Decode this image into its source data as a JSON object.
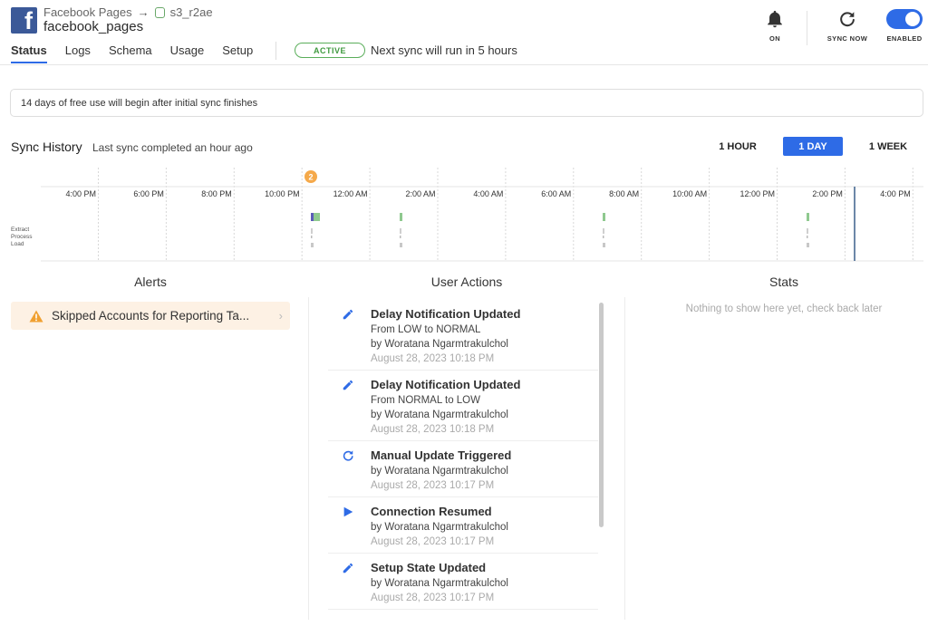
{
  "header": {
    "breadcrumb_parent": "Facebook Pages",
    "breadcrumb_dest": "s3_r2ae",
    "connector_name": "facebook_pages",
    "tabs": [
      {
        "label": "Status",
        "active": true
      },
      {
        "label": "Logs",
        "active": false
      },
      {
        "label": "Schema",
        "active": false
      },
      {
        "label": "Usage",
        "active": false
      },
      {
        "label": "Setup",
        "active": false
      }
    ],
    "status_badge": "ACTIVE",
    "next_sync": "Next sync will run in 5 hours",
    "controls": {
      "notifications_label": "ON",
      "sync_now_label": "SYNC NOW",
      "enabled_label": "ENABLED"
    }
  },
  "notice": "14 days of free use will begin after initial sync finishes",
  "sync_history": {
    "title": "Sync History",
    "subtitle": "Last sync completed an hour ago",
    "ranges": [
      {
        "label": "1 HOUR",
        "active": false
      },
      {
        "label": "1 DAY",
        "active": true
      },
      {
        "label": "1 WEEK",
        "active": false
      }
    ],
    "time_labels": [
      "4:00 PM",
      "6:00 PM",
      "8:00 PM",
      "10:00 PM",
      "12:00 AM",
      "2:00 AM",
      "4:00 AM",
      "6:00 AM",
      "8:00 AM",
      "10:00 AM",
      "12:00 PM",
      "2:00 PM",
      "4:00 PM"
    ],
    "row_labels": [
      "Extract",
      "Process",
      "Load"
    ],
    "event_badge": "2",
    "colors": {
      "extract": "#7fbf7f",
      "accent": "#2e6be6",
      "badge": "#f5a94a",
      "current_time": "#3b5f8a"
    }
  },
  "alerts": {
    "title": "Alerts",
    "items": [
      {
        "label": "Skipped Accounts for Reporting Ta...",
        "icon": "warning-icon"
      }
    ]
  },
  "user_actions": {
    "title": "User Actions",
    "items": [
      {
        "icon": "pencil-icon",
        "title": "Delay Notification Updated",
        "detail": "From LOW to NORMAL",
        "by": "by Woratana Ngarmtrakulchol",
        "time": "August 28, 2023 10:18 PM"
      },
      {
        "icon": "pencil-icon",
        "title": "Delay Notification Updated",
        "detail": "From NORMAL to LOW",
        "by": "by Woratana Ngarmtrakulchol",
        "time": "August 28, 2023 10:18 PM"
      },
      {
        "icon": "refresh-icon",
        "title": "Manual Update Triggered",
        "detail": "",
        "by": "by Woratana Ngarmtrakulchol",
        "time": "August 28, 2023 10:17 PM"
      },
      {
        "icon": "play-icon",
        "title": "Connection Resumed",
        "detail": "",
        "by": "by Woratana Ngarmtrakulchol",
        "time": "August 28, 2023 10:17 PM"
      },
      {
        "icon": "pencil-icon",
        "title": "Setup State Updated",
        "detail": "",
        "by": "by Woratana Ngarmtrakulchol",
        "time": "August 28, 2023 10:17 PM"
      }
    ]
  },
  "stats": {
    "title": "Stats",
    "empty": "Nothing to show here yet, check back later"
  }
}
